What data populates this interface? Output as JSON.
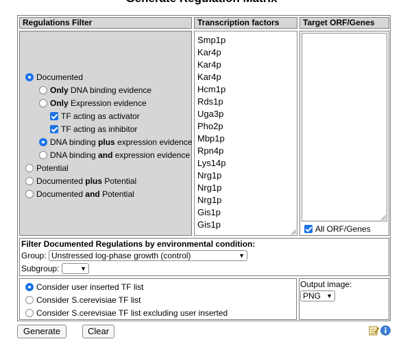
{
  "page": {
    "title": "Generate Regulation Matrix"
  },
  "headers": {
    "regulations_filter": "Regulations Filter",
    "transcription_factors": "Transcription factors",
    "target_orf_genes": "Target ORF/Genes"
  },
  "regulations": {
    "documented": "Documented",
    "only_dna_bold": "Only",
    "only_dna_rest": "DNA binding evidence",
    "only_expr_bold": "Only",
    "only_expr_rest": "Expression evidence",
    "tf_activator": "TF acting as activator",
    "tf_inhibitor": "TF acting as inhibitor",
    "dna_plus_a": "DNA binding",
    "dna_plus_b": "plus",
    "dna_plus_c": "expression evidence",
    "dna_and_a": "DNA binding",
    "dna_and_b": "and",
    "dna_and_c": "expression evidence",
    "potential": "Potential",
    "doc_plus_a": "Documented",
    "doc_plus_b": "plus",
    "doc_plus_c": "Potential",
    "doc_and_a": "Documented",
    "doc_and_b": "and",
    "doc_and_c": "Potential"
  },
  "tf_list": [
    "Smp1p",
    "Kar4p",
    "Kar4p",
    "Kar4p",
    "Hcm1p",
    "Rds1p",
    "Uga3p",
    "Pho2p",
    "Mbp1p",
    "Rpn4p",
    "Lys14p",
    "Nrg1p",
    "Nrg1p",
    "Nrg1p",
    "Gis1p",
    "Gis1p"
  ],
  "targets": {
    "all_label": "All ORF/Genes"
  },
  "env": {
    "title": "Filter Documented Regulations by environmental condition:",
    "group_label": "Group:",
    "group_value": "Unstressed log-phase growth (control)",
    "subgroup_label": "Subgroup:",
    "subgroup_value": ""
  },
  "tf_source": {
    "opt1": "Consider user inserted TF list",
    "opt2": "Consider S.cerevisiae TF list",
    "opt3": "Consider S.cerevisiae TF list excluding user inserted"
  },
  "output": {
    "label": "Output image:",
    "value": "PNG"
  },
  "buttons": {
    "generate": "Generate",
    "clear": "Clear"
  },
  "colors": {
    "accent": "#1a73e8",
    "header_bg": "#d6d6d6"
  },
  "icons": [
    "notepad-icon",
    "info-icon"
  ]
}
